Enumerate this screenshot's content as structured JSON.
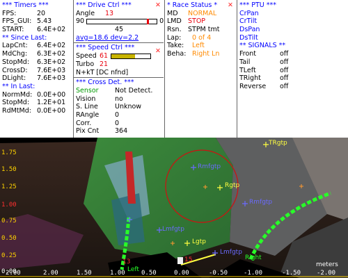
{
  "timers": {
    "title": "*** Timers ***",
    "fps_label": "FPS:",
    "fps": "20",
    "fpsgui_label": "FPS_GUI:",
    "fpsgui": "5.43",
    "start_label": "START:",
    "start": "6.4E+02",
    "since_title": "** Since Last:",
    "since": [
      {
        "label": "LapCnt:",
        "value": "6.4E+02"
      },
      {
        "label": "MdChg:",
        "value": "6.3E+02"
      },
      {
        "label": "StopMd:",
        "value": "6.3E+02"
      },
      {
        "label": "CrossD:",
        "value": "7.6E+03"
      },
      {
        "label": "DLight:",
        "value": "7.6E+03"
      }
    ],
    "in_title": "** In Last:",
    "in": [
      {
        "label": "NormMd:",
        "value": "0.0E+00"
      },
      {
        "label": "StopMd:",
        "value": "1.2E+01"
      },
      {
        "label": "RdMtMd:",
        "value": "0.0E+00"
      }
    ]
  },
  "drive": {
    "title": "*** Drive Ctrl ***",
    "angle_label": "Angle",
    "angle": "13",
    "slider_min": "90",
    "slider_max": "0",
    "slider_level": 0.86,
    "slider_center": "45",
    "stats": "avg=18.6 dev=2.2",
    "speed_title": "*** Speed Ctrl ***",
    "speed_label": "Speed",
    "speed": "61",
    "speed_level": 0.61,
    "turbo_label": "Turbo",
    "turbo": "21",
    "nkt": "N+kT [DC nfnd]",
    "cross_title": "*** Cross Det. ***",
    "cross": [
      {
        "label": "Sensor",
        "value": "Not Detect."
      },
      {
        "label": "Vision",
        "value": "no"
      },
      {
        "label": "S. Line",
        "value": "Unknow"
      },
      {
        "label": "RAngle",
        "value": "0"
      },
      {
        "label": "Corr.",
        "value": "0"
      },
      {
        "label": "Pix Cnt",
        "value": "364"
      }
    ]
  },
  "race": {
    "title": "* Race Status *",
    "rows": [
      {
        "label": "MD",
        "value": "NORMAL",
        "color": "#ff8a00"
      },
      {
        "label": "LMD",
        "value": "STOP",
        "color": "#e8000c"
      },
      {
        "label": "Rsn.",
        "value": "STPM tmt",
        "color": "#000000"
      },
      {
        "label": "Lap:",
        "value": "0 of 4",
        "color": "#ff8a00"
      },
      {
        "label": "Take:",
        "value": "Left",
        "color": "#ff8a00"
      },
      {
        "label": "Beha:",
        "value": "Right Ln",
        "color": "#ff8a00"
      }
    ]
  },
  "ptu": {
    "title": "*** PTU ***",
    "items": [
      "CrPan",
      "CrTilt",
      "DsPan",
      "DsTilt"
    ],
    "signals_title": "** SIGNALS **",
    "signals": [
      {
        "label": "Front",
        "value": "off"
      },
      {
        "label": "Tail",
        "value": "off"
      },
      {
        "label": "TLeft",
        "value": "off"
      },
      {
        "label": "TRight",
        "value": "off"
      },
      {
        "label": "Reverse",
        "value": "off"
      }
    ]
  },
  "camera": {
    "y_ticks": [
      "1.75",
      "1.50",
      "1.25",
      "1.00",
      "0.75",
      "0.50",
      "0.25",
      "0.00"
    ],
    "x_ticks": [
      "2.00",
      "1.50",
      "1.00",
      "0.50",
      "0.00",
      "-0.50",
      "-1.00",
      "-1.50",
      "-2.00"
    ],
    "x_tick_2": "2.00",
    "units": "meters",
    "targets": [
      {
        "label": "TRgtp",
        "color": "#ffff40"
      },
      {
        "label": "Rmfgtp",
        "color": "#6b6bff"
      },
      {
        "label": "Rgtp",
        "color": "#ffff40"
      },
      {
        "label": "Rmfgtp",
        "color": "#6b6bff"
      },
      {
        "label": "Lmfgtp",
        "color": "#6b6bff"
      },
      {
        "label": "Lgtp",
        "color": "#ffff40"
      },
      {
        "label": "Lmfgtp",
        "color": "#6b6bff"
      }
    ],
    "left_label": "Left",
    "right_label": "Right",
    "num_13": "13",
    "num_15": "15"
  }
}
